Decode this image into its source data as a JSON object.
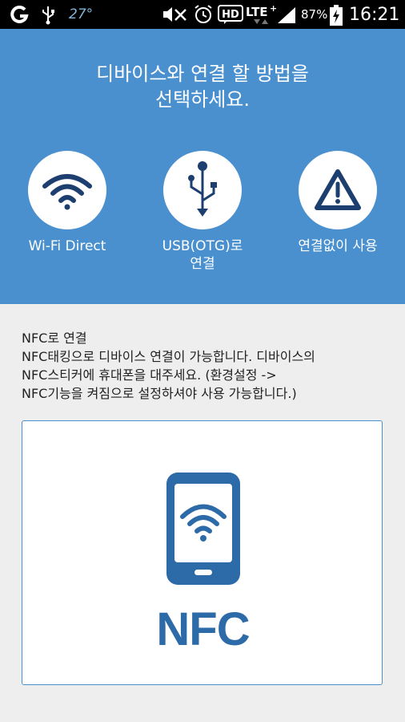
{
  "status_bar": {
    "temperature": "27°",
    "battery_percent": "87%",
    "time": "16:21",
    "icons": [
      "g-logo-icon",
      "usb-icon",
      "mute-icon",
      "alarm-icon",
      "hd-icon",
      "lte-icon",
      "signal-icon",
      "battery-charging-icon"
    ]
  },
  "header": {
    "title_line1": "디바이스와 연결 할 방법을",
    "title_line2": "선택하세요.",
    "options": [
      {
        "label": "Wi-Fi Direct",
        "icon": "wifi-icon"
      },
      {
        "label_line1": "USB(OTG)로",
        "label_line2": "연결",
        "icon": "usb-icon"
      },
      {
        "label": "연결없이 사용",
        "icon": "warning-icon"
      }
    ]
  },
  "nfc": {
    "heading": "NFC로 연결",
    "lines": [
      "NFC태킹으로 디바이스 연결이 가능합니다. 디바이스의",
      "NFC스티커에 휴대폰을 대주세요. (환경설정 ->",
      "NFC기능을 켜짐으로 설정하셔야 사용 가능합니다.)"
    ],
    "logo_text": "NFC",
    "icon": "nfc-phone-icon"
  },
  "colors": {
    "header_bg": "#4a90cf",
    "icon_dark": "#1d3f70",
    "nfc_blue": "#2d6aa8",
    "content_bg": "#eeeeee"
  }
}
